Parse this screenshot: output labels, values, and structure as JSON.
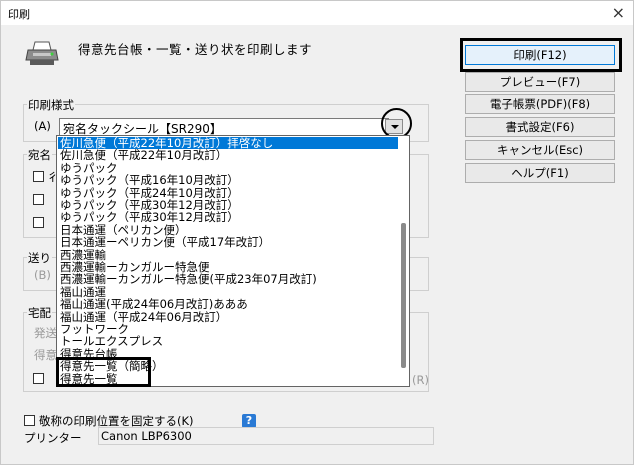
{
  "window": {
    "title": "印刷",
    "close": "×"
  },
  "heading": "得意先台帳・一覧・送り状を印刷します",
  "buttons": {
    "print": "印刷(F12)",
    "preview": "プレビュー(F7)",
    "pdf": "電子帳票(PDF)(F8)",
    "format": "書式設定(F6)",
    "cancel": "キャンセル(Esc)",
    "help": "ヘルプ(F1)"
  },
  "print_format": {
    "group_label": "印刷様式",
    "accel": "(A)",
    "selected_value": "宛名タックシール【SR290】",
    "options": [
      "佐川急便（平成22年10月改訂）拝啓なし",
      "佐川急便（平成22年10月改訂）",
      "ゆうパック",
      "ゆうパック（平成16年10月改訂）",
      "ゆうパック（平成24年10月改訂）",
      "ゆうパック（平成30年12月改訂）",
      "ゆうパック（平成30年12月改訂）",
      "日本通運（ペリカン便）",
      "日本通運ーペリカン便（平成17年改訂）",
      "西濃運輸",
      "西濃運輸ーカンガルー特急便",
      "西濃運輸ーカンガルー特急便(平成23年07月改訂)",
      "福山通運",
      "福山通運(平成24年06月改訂)あああ",
      "福山通運（平成24年06月改訂）",
      "フットワーク",
      "トールエクスプレス",
      "得意先台帳",
      "得意先一覧（簡略）",
      "得意先一覧"
    ],
    "selected_index": 0
  },
  "behind": {
    "group2_label": "宛名",
    "group2_partial": "彳",
    "group3_label": "送り",
    "group3_partial": "(B)",
    "group4_label": "宅配",
    "hint1": "発送",
    "hint2": "得意",
    "r_accel": "(R)"
  },
  "fix_position": {
    "label": "敬称の印刷位置を固定する(K)",
    "help": "?"
  },
  "printer": {
    "label": "プリンター",
    "value": "Canon LBP6300"
  }
}
